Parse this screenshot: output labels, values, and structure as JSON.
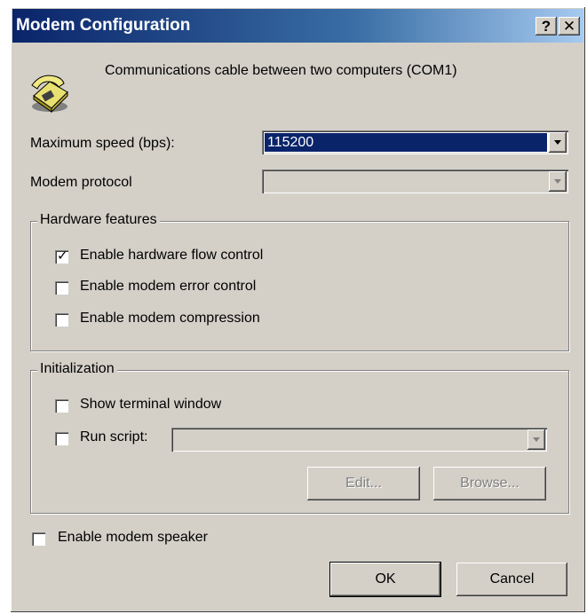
{
  "window": {
    "title": "Modem Configuration",
    "help_button": "?",
    "close_button": "✕"
  },
  "header": {
    "icon": "telephone-icon",
    "device_name": "Communications cable between two computers (COM1)"
  },
  "speed": {
    "label": "Maximum speed (bps):",
    "value": "115200"
  },
  "protocol": {
    "label": "Modem protocol",
    "value": ""
  },
  "hardware": {
    "legend": "Hardware features",
    "options": [
      {
        "label": "Enable hardware flow control",
        "checked": true
      },
      {
        "label": "Enable modem error control",
        "checked": false
      },
      {
        "label": "Enable modem compression",
        "checked": false
      }
    ]
  },
  "initialization": {
    "legend": "Initialization",
    "show_terminal": {
      "label": "Show terminal window",
      "checked": false
    },
    "run_script": {
      "label": "Run script:",
      "checked": false,
      "value": ""
    },
    "edit_label": "Edit...",
    "browse_label": "Browse..."
  },
  "speaker": {
    "label": "Enable modem speaker",
    "checked": false
  },
  "buttons": {
    "ok": "OK",
    "cancel": "Cancel"
  },
  "colors": {
    "title_start": "#0a246a",
    "title_end": "#a6caf0",
    "face": "#d4d0c8",
    "selection": "#0a246a"
  }
}
